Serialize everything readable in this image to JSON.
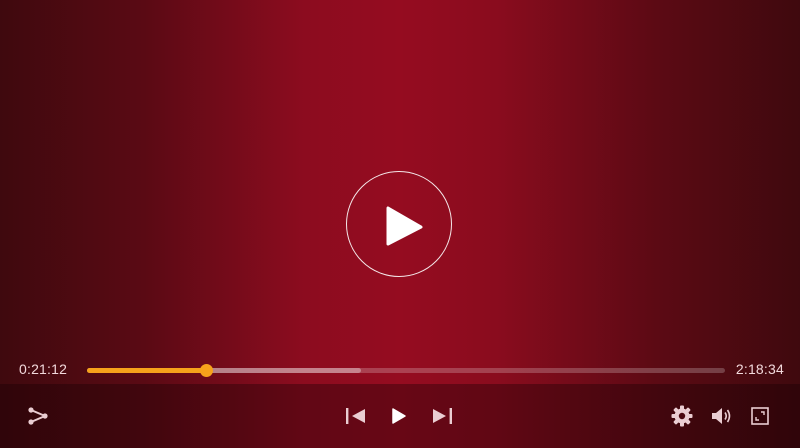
{
  "player": {
    "current_time": "0:21:12",
    "total_time": "2:18:34",
    "progress_fraction": 0.186,
    "buffered_fraction": 0.43,
    "accent_color": "#f6a21b"
  },
  "controls": {
    "left": [
      "share-icon"
    ],
    "center": [
      "skip-previous-icon",
      "play-icon",
      "skip-next-icon"
    ],
    "right": [
      "settings-gear-icon",
      "volume-icon",
      "fullscreen-icon"
    ]
  }
}
